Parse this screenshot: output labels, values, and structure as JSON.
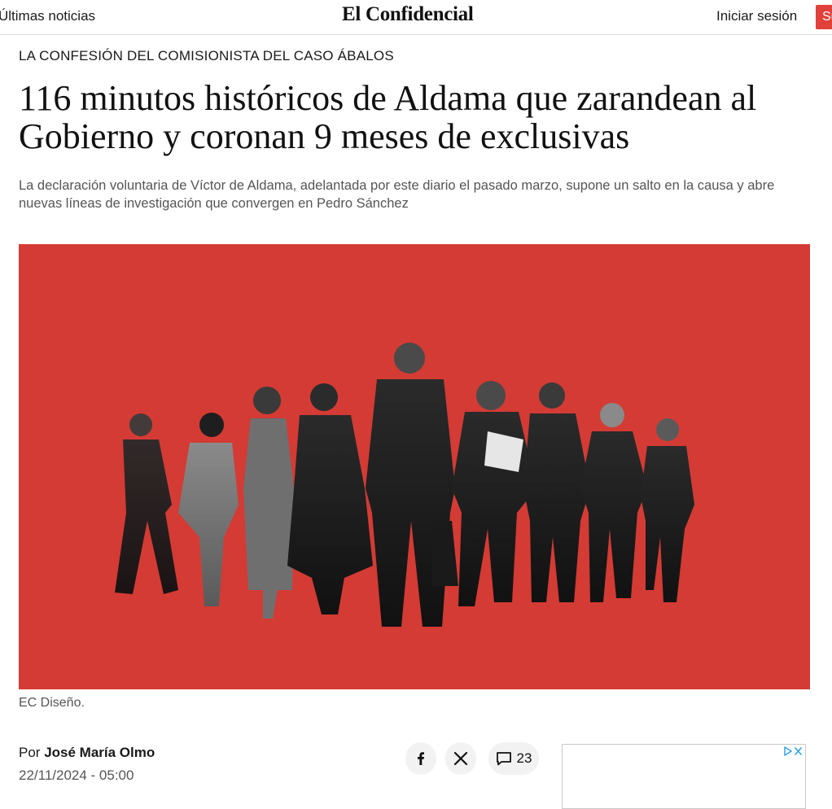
{
  "header": {
    "latest_news": "Últimas noticias",
    "logo": "El Confidencial",
    "login": "Iniciar sesión",
    "subscribe": "Suscríbete"
  },
  "article": {
    "kicker": "LA CONFESIÓN DEL COMISIONISTA DEL CASO ÁBALOS",
    "headline": "116 minutos históricos de Aldama que zarandean al Gobierno y coronan 9 meses de exclusivas",
    "subtitle": "La declaración voluntaria de Víctor de Aldama, adelantada por este diario el pasado marzo, supone un salto en la causa y abre nuevas líneas de investigación que convergen en Pedro Sánchez",
    "image_caption": "EC Diseño.",
    "byline_prefix": "Por",
    "author": "José María Olmo",
    "date": "22/11/2024 - 05:00"
  },
  "share": {
    "facebook_icon": "facebook-icon",
    "x_icon": "x-icon",
    "comments_icon": "comment-icon",
    "comments_count": "23"
  },
  "ad": {
    "adchoices_icon": "adchoices-icon",
    "close_icon": "close-icon"
  },
  "colors": {
    "brand_red": "#d33b34",
    "subscribe_red": "#e0413a"
  }
}
